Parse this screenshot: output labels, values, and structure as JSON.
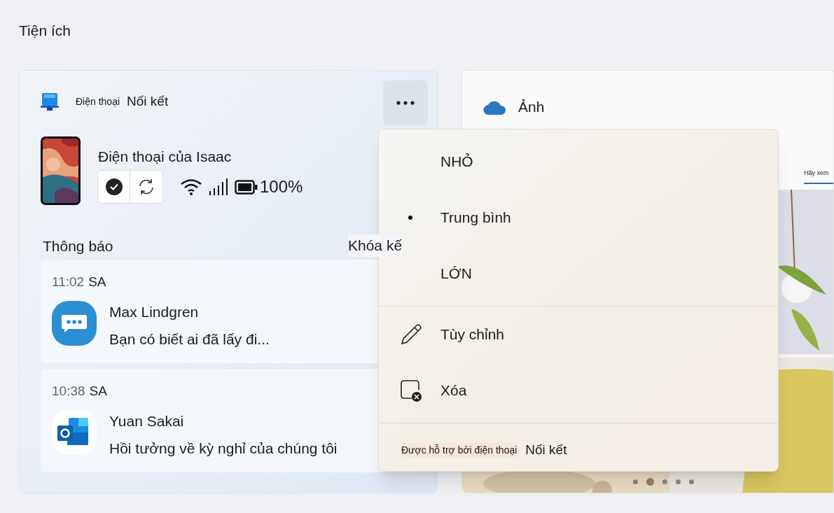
{
  "page_title": "Tiện ích",
  "phone_widget": {
    "app_caption": "Điện thoại",
    "app_name": "Nối kết",
    "device_name": "Điện thoại của Isaac",
    "battery": "100%",
    "notifications_title": "Thông báo",
    "lock_link": "Khóa kế",
    "notifications": [
      {
        "kind": "messages",
        "time": "11:02",
        "period": "SA",
        "sender": "Max Lindgren",
        "message": "Bạn có biết ai đã lấy đi..."
      },
      {
        "kind": "outlook",
        "time": "10:38",
        "period": "SA",
        "sender": "Yuan Sakai",
        "message": "Hồi tưởng về kỳ nghỉ của chúng tôi"
      }
    ]
  },
  "photos_widget": {
    "title": "Ảnh",
    "tab_label": "Hãy xem",
    "pages": [
      {
        "selected": false
      },
      {
        "selected": true
      },
      {
        "selected": false
      },
      {
        "selected": false
      },
      {
        "selected": false
      }
    ]
  },
  "menu": {
    "sizes": [
      {
        "label": "NHỎ",
        "selected": false
      },
      {
        "label": "Trung bình",
        "selected": true
      },
      {
        "label": "LỚN",
        "selected": false
      }
    ],
    "actions": [
      {
        "kind": "edit",
        "label": "Tùy chỉnh"
      },
      {
        "kind": "remove",
        "label": "Xóa"
      }
    ],
    "footer": {
      "caption": "Được hỗ trợ bởi điện thoại",
      "app_name": "Nối kết"
    }
  }
}
